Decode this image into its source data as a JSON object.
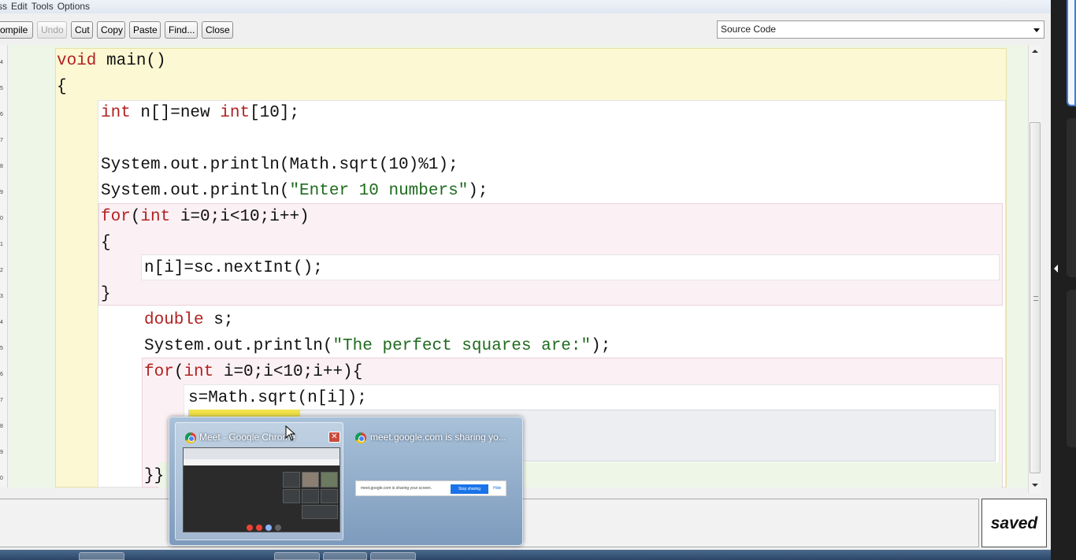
{
  "menu": {
    "items": [
      "ss",
      "Edit",
      "Tools",
      "Options"
    ]
  },
  "toolbar": {
    "compile": "ompile",
    "undo": "Undo",
    "cut": "Cut",
    "copy": "Copy",
    "paste": "Paste",
    "find": "Find...",
    "close": "Close"
  },
  "view_selector": {
    "value": "Source Code"
  },
  "gutter": {
    "numbers": [
      "4",
      "5",
      "6",
      "7",
      "8",
      "9",
      "0",
      "1",
      "2",
      "3",
      "4",
      "5",
      "6",
      "7",
      "8",
      "9",
      "0"
    ]
  },
  "code": {
    "l1a": "void",
    "l1b": " main()",
    "l2": "{",
    "l3a": "int",
    "l3b": " n[]=new ",
    "l3c": "int",
    "l3d": "[10];",
    "l4": "System.out.println(Math.sqrt(10)%1);",
    "l5a": "System.out.println(",
    "l5b": "\"Enter 10 numbers\"",
    "l5c": ");",
    "l6a": "for",
    "l6b": "(",
    "l6c": "int",
    "l6d": " i=0;i<10;i++)",
    "l7": "{",
    "l8": "n[i]=sc.nextInt();",
    "l9": "}",
    "l10a": "double",
    "l10b": " s;",
    "l11a": "System.out.println(",
    "l11b": "\"The perfect squares are:\"",
    "l11c": ");",
    "l12a": "for",
    "l12b": "(",
    "l12c": "int",
    "l12d": " i=0;i<10;i++){",
    "l13": "s=Math.sqrt(n[i]);",
    "l16": "}}"
  },
  "status": {
    "saved": "saved"
  },
  "taskbar_popup": {
    "window1_title": "Meet - Google Chrome",
    "window2_title": "meet.google.com is sharing yo...",
    "share_text": "meet.google.com is sharing your screen.",
    "stop_button": "Stop sharing",
    "hide_link": "Hide"
  },
  "colors": {
    "keyword": "#b22222",
    "string": "#1e6b1e",
    "accent": "#3d7be0"
  }
}
